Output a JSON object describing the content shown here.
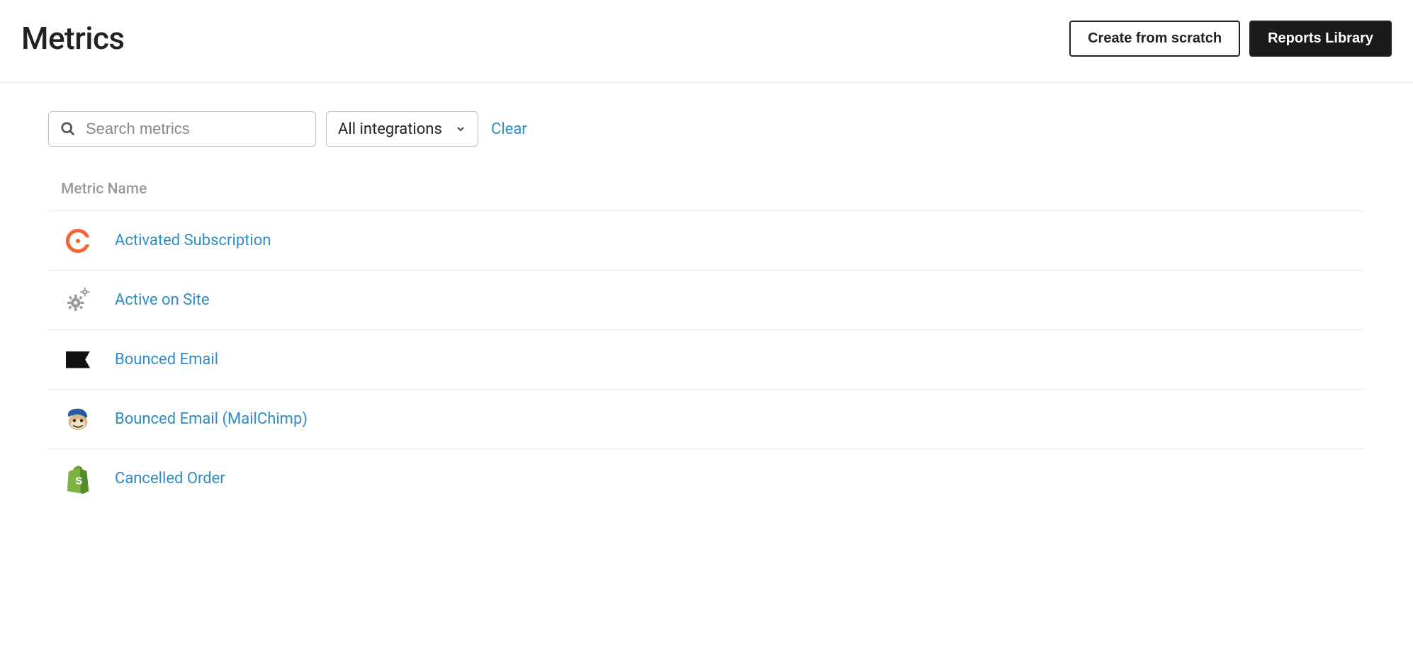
{
  "header": {
    "title": "Metrics",
    "create_button": "Create from scratch",
    "library_button": "Reports Library"
  },
  "filters": {
    "search_placeholder": "Search metrics",
    "integrations_selected": "All integrations",
    "clear_label": "Clear"
  },
  "table": {
    "column_header": "Metric Name",
    "rows": [
      {
        "icon": "chargify",
        "label": "Activated Subscription"
      },
      {
        "icon": "gears",
        "label": "Active on Site"
      },
      {
        "icon": "flag",
        "label": "Bounced Email"
      },
      {
        "icon": "mailchimp",
        "label": "Bounced Email (MailChimp)"
      },
      {
        "icon": "shopify",
        "label": "Cancelled Order"
      }
    ]
  }
}
